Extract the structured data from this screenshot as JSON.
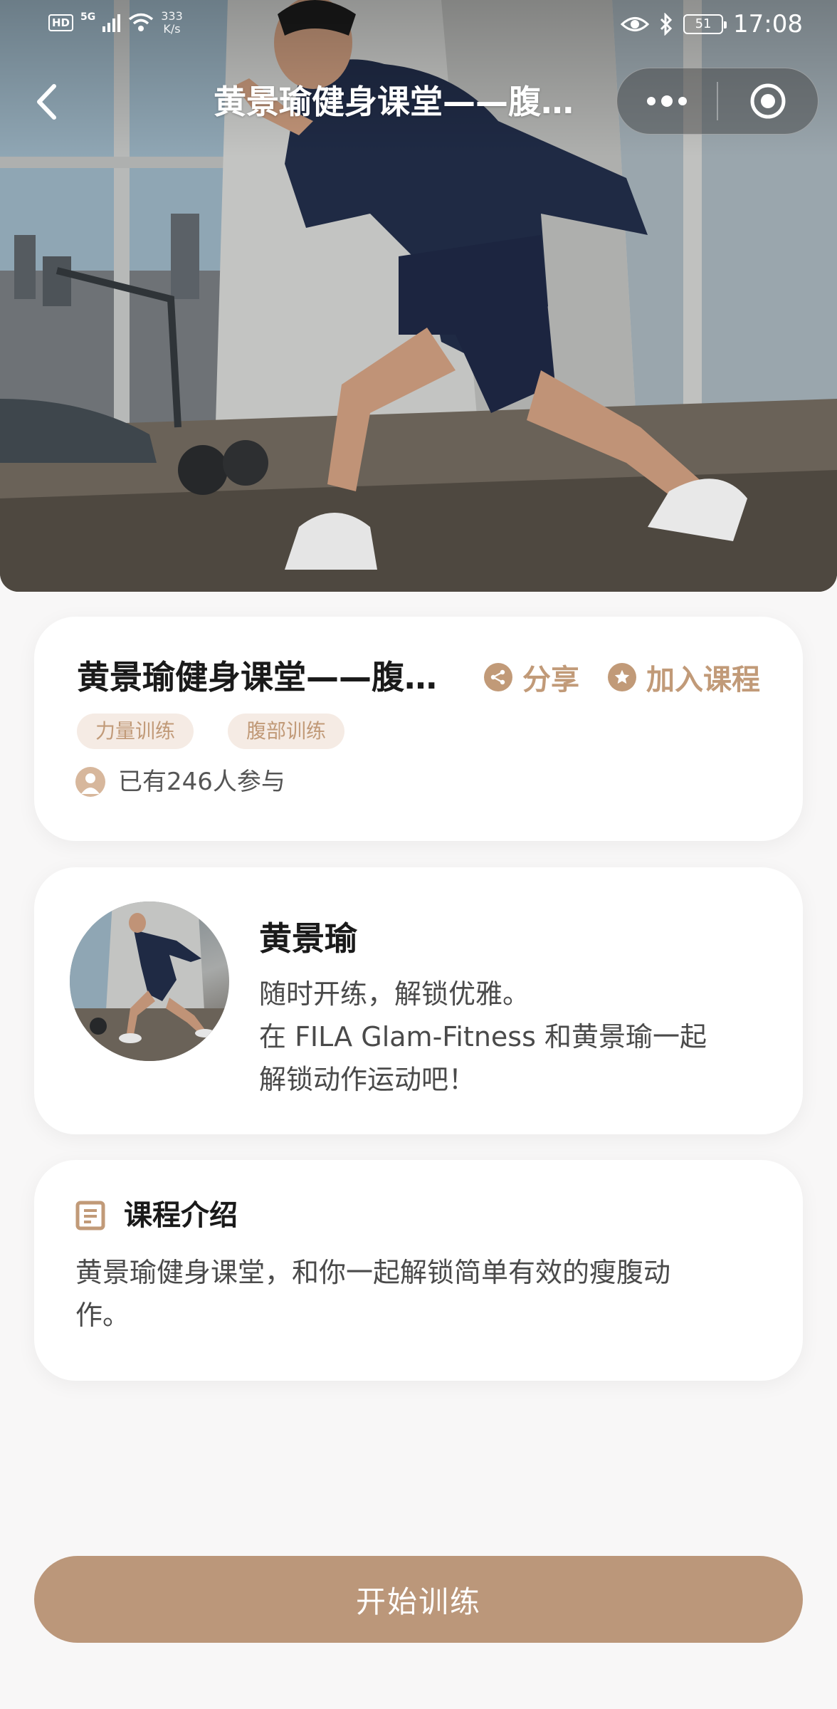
{
  "status_bar": {
    "hd_label": "HD",
    "network": "5G",
    "speed_value": "333",
    "speed_unit": "K/s",
    "battery_level": "51",
    "time": "17:08"
  },
  "nav": {
    "title": "黄景瑜健身课堂——腹部训练",
    "back_icon": "chevron-left-icon",
    "more_icon": "more-dots-icon",
    "close_icon": "target-close-icon"
  },
  "hero": {
    "image_description_icon": "hero-photo"
  },
  "course": {
    "title": "黄景瑜健身课堂——腹部训练",
    "share_label": "分享",
    "join_label": "加入课程",
    "tags": [
      "力量训练",
      "腹部训练"
    ],
    "participants": "已有246人参与"
  },
  "coach": {
    "name": "黄景瑜",
    "bio_lines": [
      "随时开练，解锁优雅。",
      "在 FILA Glam-Fitness 和黄景瑜一起",
      "解锁动作运动吧！"
    ]
  },
  "intro": {
    "title": "课程介绍",
    "text_lines": [
      "黄景瑜健身课堂，和你一起解锁简单有效的瘦腹动",
      "作。"
    ]
  },
  "start_button": {
    "label": "开始训练"
  },
  "colors": {
    "accent": "#c19a78",
    "button": "#bb977a",
    "tag_bg": "#f5ebe4",
    "page_bg": "#f8f7f7"
  }
}
